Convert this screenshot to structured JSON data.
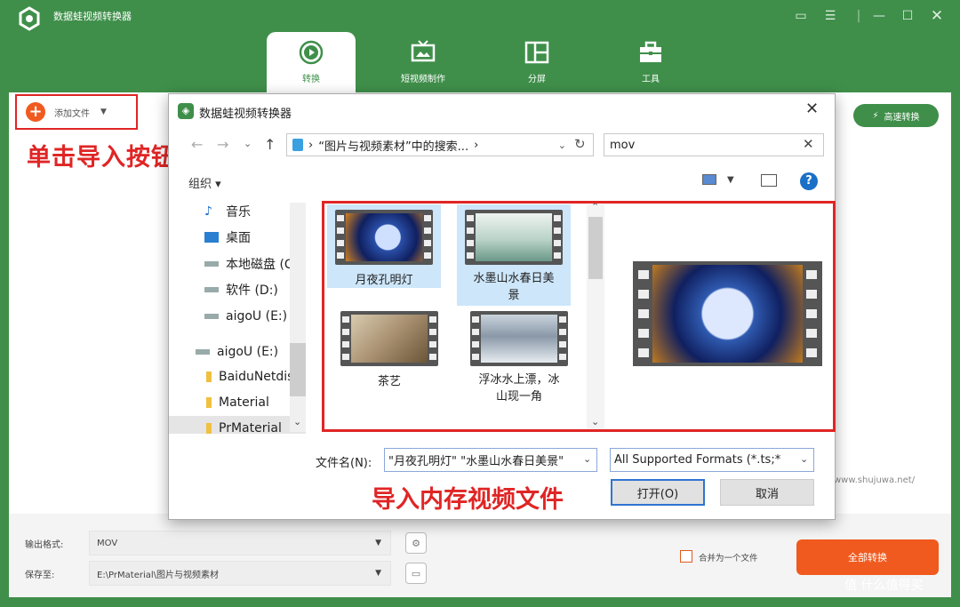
{
  "app": {
    "title": "数据蛙视频转换器"
  },
  "tabs": [
    {
      "label": "转换",
      "icon": "convert-icon",
      "active": true
    },
    {
      "label": "短视频制作",
      "icon": "tv-icon",
      "active": false
    },
    {
      "label": "分屏",
      "icon": "split-screen-icon",
      "active": false
    },
    {
      "label": "工具",
      "icon": "toolbox-icon",
      "active": false
    }
  ],
  "toolbar": {
    "add_file": "添加文件",
    "fast_convert": "高速转换"
  },
  "annotations": {
    "import_button": "单击导入按钮",
    "import_files": "导入内存视频文件"
  },
  "watermark": {
    "url": "www.shujuwa.net/",
    "corner": "值 什么值得买"
  },
  "bottom": {
    "output_format_label": "输出格式:",
    "output_format_value": "MOV",
    "save_to_label": "保存至:",
    "save_to_value": "E:\\PrMaterial\\图片与视频素材",
    "merge_label": "合并为一个文件",
    "convert_all": "全部转换"
  },
  "dialog": {
    "title": "数据蛙视频转换器",
    "address": "“图片与视频素材”中的搜索...",
    "search_value": "mov",
    "organize": "组织 ▾",
    "nav_items": [
      {
        "label": "音乐",
        "icon": "music-icon"
      },
      {
        "label": "桌面",
        "icon": "desktop-icon"
      },
      {
        "label": "本地磁盘 (C:)",
        "icon": "drive-icon"
      },
      {
        "label": "软件 (D:)",
        "icon": "drive-icon"
      },
      {
        "label": "aigoU (E:)",
        "icon": "drive-icon"
      },
      {
        "label": "aigoU (E:)",
        "icon": "drive-icon"
      },
      {
        "label": "BaiduNetdisk",
        "icon": "folder-icon"
      },
      {
        "label": "Material",
        "icon": "folder-icon"
      },
      {
        "label": "PrMaterial",
        "icon": "folder-icon"
      }
    ],
    "files": [
      {
        "name": "月夜孔明灯",
        "selected": true
      },
      {
        "name": "水墨山水春日美景",
        "selected": true
      },
      {
        "name": "茶艺",
        "selected": false
      },
      {
        "name": "浮冰水上漂，冰山现一角",
        "selected": false
      }
    ],
    "file_name_label": "文件名(N):",
    "file_name_value": "\"月夜孔明灯\" \"水墨山水春日美景\"",
    "file_type_value": "All Supported Formats (*.ts;*",
    "open_button": "打开(O)",
    "cancel_button": "取消"
  }
}
